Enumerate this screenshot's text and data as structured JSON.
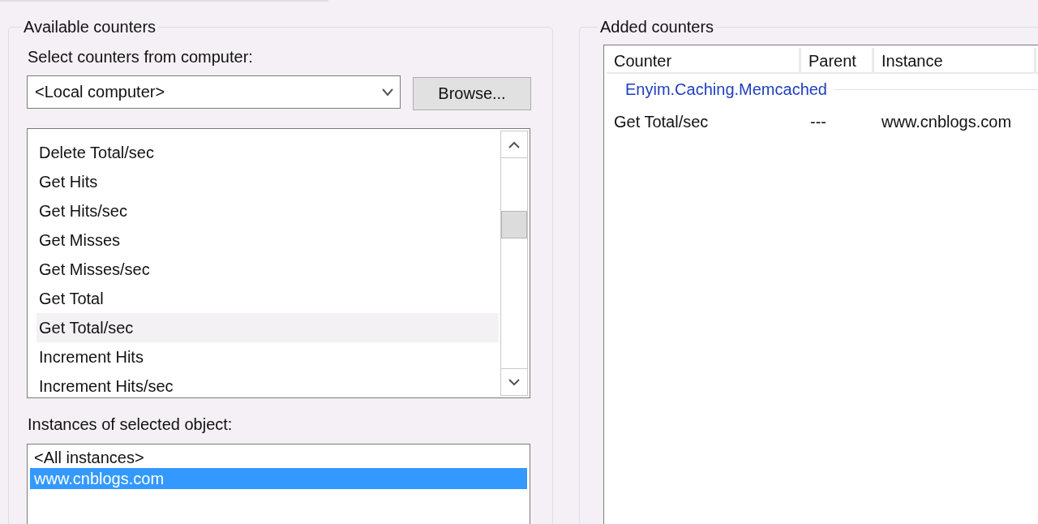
{
  "available_counters": {
    "title": "Available counters",
    "computer_label": "Select counters from computer:",
    "computer_value": "<Local computer>",
    "browse_button": "Browse...",
    "counters": [
      {
        "label": "Delete Total/sec",
        "selected": false
      },
      {
        "label": "Get Hits",
        "selected": false
      },
      {
        "label": "Get Hits/sec",
        "selected": false
      },
      {
        "label": "Get Misses",
        "selected": false
      },
      {
        "label": "Get Misses/sec",
        "selected": false
      },
      {
        "label": "Get Total",
        "selected": false
      },
      {
        "label": "Get Total/sec",
        "selected": true
      },
      {
        "label": "Increment Hits",
        "selected": false
      },
      {
        "label": "Increment Hits/sec",
        "selected": false
      }
    ],
    "instances_label": "Instances of selected object:",
    "instances": [
      {
        "label": "<All instances>",
        "selected": false
      },
      {
        "label": "www.cnblogs.com",
        "selected": true
      }
    ]
  },
  "added_counters": {
    "title": "Added counters",
    "columns": [
      "Counter",
      "Parent",
      "Instance"
    ],
    "groups": [
      {
        "name": "Enyim.Caching.Memcached",
        "rows": [
          {
            "counter": "Get Total/sec",
            "parent": "---",
            "instance": "www.cnblogs.com"
          }
        ]
      }
    ]
  }
}
